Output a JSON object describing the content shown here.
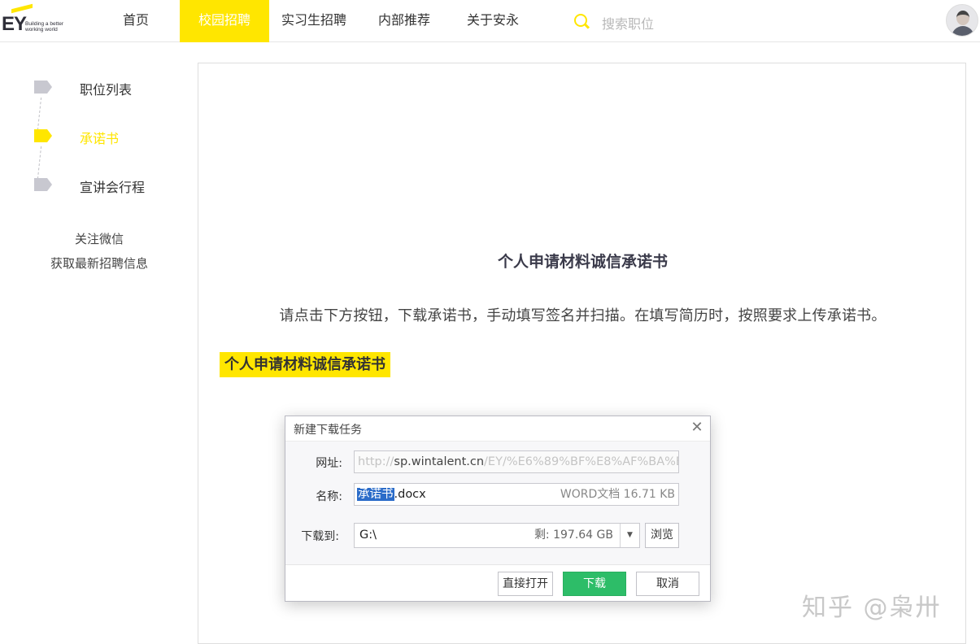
{
  "header": {
    "logo_text": "EY",
    "logo_tagline_1": "Building a better",
    "logo_tagline_2": "working world",
    "nav": [
      "首页",
      "校园招聘",
      "实习生招聘",
      "内部推荐",
      "关于安永"
    ],
    "active_nav": "校园招聘",
    "search_placeholder": "搜索职位"
  },
  "sidebar": {
    "steps": [
      "职位列表",
      "承诺书",
      "宣讲会行程"
    ],
    "current_step": "承诺书",
    "follow_line1": "关注微信",
    "follow_line2": "获取最新招聘信息"
  },
  "main": {
    "title": "个人申请材料诚信承诺书",
    "description": "请点击下方按钮，下载承诺书，手动填写签名并扫描。在填写简历时，按照要求上传承诺书。",
    "download_link": "个人申请材料诚信承诺书"
  },
  "dialog": {
    "title": "新建下载任务",
    "url_label": "网址:",
    "url_prefix": "http://",
    "url_host": "sp.wintalent.cn",
    "url_path": "/EY/%E6%89%BF%E8%AF%BA%E",
    "name_label": "名称:",
    "name_selected": "承诺书",
    "name_ext": ".docx",
    "file_meta": "WORD文档 16.71 KB",
    "dir_label": "下载到:",
    "dir_value": "G:\\",
    "free_space": "剩: 197.64 GB",
    "browse_label": "浏览",
    "open_label": "直接打开",
    "download_label": "下载",
    "cancel_label": "取消"
  },
  "watermark": "知乎 @枭卅",
  "colors": {
    "accent_yellow": "#ffe600",
    "download_green": "#2dbd68",
    "selection_blue": "#2b6cc9"
  }
}
